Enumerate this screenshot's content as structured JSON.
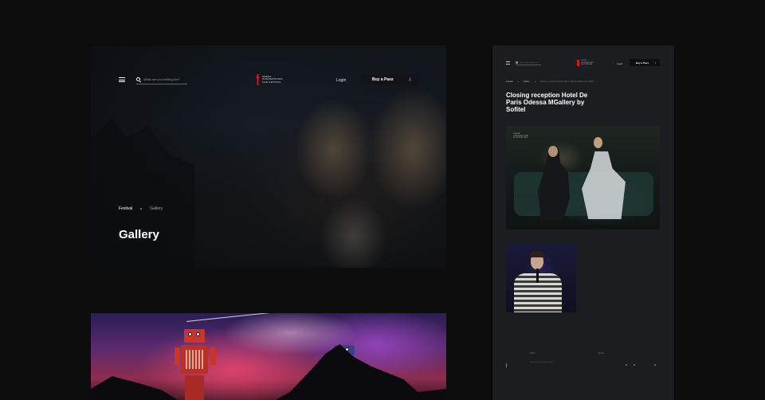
{
  "left_page": {
    "header": {
      "search_placeholder": "What are you looking for?",
      "logo_text": "Odesa International Film Festival",
      "login_label": "Login",
      "buy_label": "Buy a Pass",
      "buy_icon": "arrow-down-icon"
    },
    "breadcrumb": {
      "items": [
        "Festival",
        "Gallery"
      ]
    },
    "title": "Gallery"
  },
  "right_page": {
    "header": {
      "search_placeholder": "What are you looking for?",
      "logo_text": "Odesa International Film Festival",
      "login_label": "Login",
      "buy_label": "Buy a Pass"
    },
    "breadcrumb": {
      "items": [
        "Festival",
        "Gallery",
        "Closing reception Hotel De Paris Odessa MGallery by Sofitel"
      ]
    },
    "title": "Closing reception Hotel De Paris Odessa MGallery by Sofitel",
    "photo_caption": "Odesa International Film Festival",
    "footer": {
      "col1_label": "Office",
      "col1_text": "Odesa International Film Festival",
      "col2_label": "Socials"
    }
  },
  "colors": {
    "background": "#0c0c0d",
    "panel": "#1c1d20",
    "brand_red": "#d8141d"
  }
}
